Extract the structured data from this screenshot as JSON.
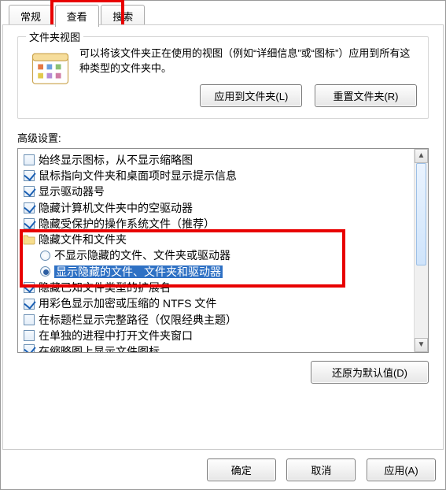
{
  "tabs": {
    "general": "常规",
    "view": "查看",
    "search": "搜索"
  },
  "groupbox": {
    "legend": "文件夹视图",
    "desc": "可以将该文件夹正在使用的视图（例如“详细信息”或“图标”）应用到所有这种类型的文件夹中。",
    "apply_btn": "应用到文件夹(L)",
    "reset_btn": "重置文件夹(R)"
  },
  "advanced": {
    "label": "高级设置:",
    "items": [
      {
        "type": "check",
        "checked": false,
        "text": "始终显示图标，从不显示缩略图"
      },
      {
        "type": "check",
        "checked": true,
        "text": "鼠标指向文件夹和桌面项时显示提示信息"
      },
      {
        "type": "check",
        "checked": true,
        "text": "显示驱动器号"
      },
      {
        "type": "check",
        "checked": true,
        "text": "隐藏计算机文件夹中的空驱动器"
      },
      {
        "type": "check",
        "checked": true,
        "text": "隐藏受保护的操作系统文件（推荐）"
      },
      {
        "type": "folder",
        "text": "隐藏文件和文件夹"
      },
      {
        "type": "radio",
        "checked": false,
        "text": "不显示隐藏的文件、文件夹或驱动器",
        "indent": true
      },
      {
        "type": "radio",
        "checked": true,
        "text": "显示隐藏的文件、文件夹和驱动器",
        "indent": true,
        "selected": true
      },
      {
        "type": "check",
        "checked": true,
        "text": "隐藏已知文件类型的扩展名"
      },
      {
        "type": "check",
        "checked": true,
        "text": "用彩色显示加密或压缩的 NTFS 文件"
      },
      {
        "type": "check",
        "checked": false,
        "text": "在标题栏显示完整路径（仅限经典主题）"
      },
      {
        "type": "check",
        "checked": false,
        "text": "在单独的进程中打开文件夹窗口"
      },
      {
        "type": "check",
        "checked": true,
        "cut": true,
        "text": "在缩略图上显示文件图标"
      }
    ]
  },
  "restore_btn": "还原为默认值(D)",
  "bottom": {
    "ok": "确定",
    "cancel": "取消",
    "apply": "应用(A)"
  }
}
